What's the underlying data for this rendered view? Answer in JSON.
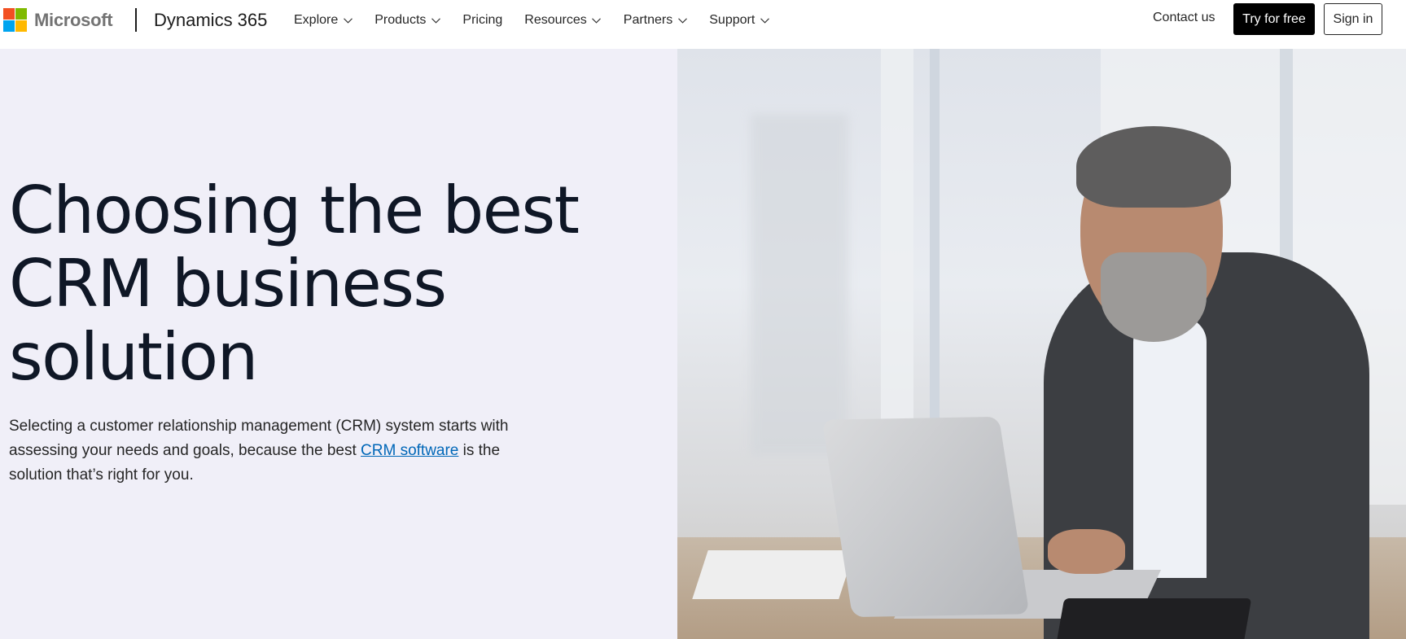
{
  "header": {
    "brand": {
      "wordmark": "Microsoft",
      "logo_colors": [
        "#f25022",
        "#7fba00",
        "#00a4ef",
        "#ffb900"
      ]
    },
    "product_name": "Dynamics 365",
    "nav": [
      {
        "label": "Explore",
        "icon": "chevron-down-icon"
      },
      {
        "label": "Products",
        "icon": "chevron-down-icon"
      },
      {
        "label": "Pricing"
      },
      {
        "label": "Resources",
        "icon": "chevron-down-icon"
      },
      {
        "label": "Partners",
        "icon": "chevron-down-icon"
      },
      {
        "label": "Support",
        "icon": "chevron-down-icon"
      }
    ],
    "contact_label": "Contact us",
    "try_label": "Try for free",
    "sign_in_label": "Sign in"
  },
  "hero": {
    "title_lines": [
      "Choosing the best",
      "CRM business",
      "solution"
    ],
    "body_before": "Selecting a customer relationship management (CRM) system starts with assessing your needs and goals, because the best ",
    "body_link": "CRM software",
    "body_after": " is the solution that’s right for you.",
    "image_alt": "Man with gray beard working on a laptop at a desk",
    "colors": {
      "left_background": "#f0eff8",
      "title": "#0f1726",
      "link": "#0067b8",
      "button": "#000000"
    }
  }
}
